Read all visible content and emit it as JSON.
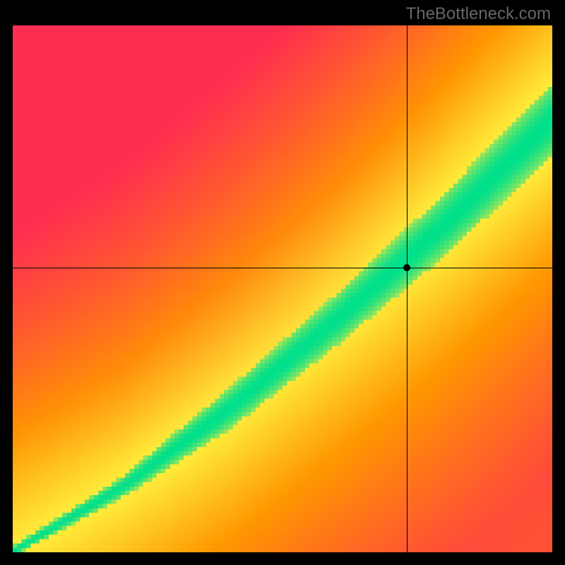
{
  "watermark": "TheBottleneck.com",
  "chart_data": {
    "type": "heatmap",
    "title": "",
    "xlabel": "",
    "ylabel": "",
    "xlim": [
      0,
      100
    ],
    "ylim": [
      0,
      100
    ],
    "grid_size": 120,
    "colormap": {
      "green": "#00E08C",
      "yellow": "#FFEB3B",
      "orange": "#FF9800",
      "red": "#FF2E51"
    },
    "curve": {
      "description": "Green band along y ≈ 0.4·x^1.3 from origin to upper-right, widening with x",
      "samples": [
        {
          "x": 0,
          "y": 0,
          "band_halfwidth": 1
        },
        {
          "x": 20,
          "y": 12,
          "band_halfwidth": 2
        },
        {
          "x": 40,
          "y": 27,
          "band_halfwidth": 4
        },
        {
          "x": 60,
          "y": 44,
          "band_halfwidth": 5
        },
        {
          "x": 80,
          "y": 62,
          "band_halfwidth": 6
        },
        {
          "x": 100,
          "y": 82,
          "band_halfwidth": 7
        }
      ]
    },
    "crosshair": {
      "x": 73,
      "y": 54
    },
    "marker": {
      "x": 73,
      "y": 54
    }
  }
}
